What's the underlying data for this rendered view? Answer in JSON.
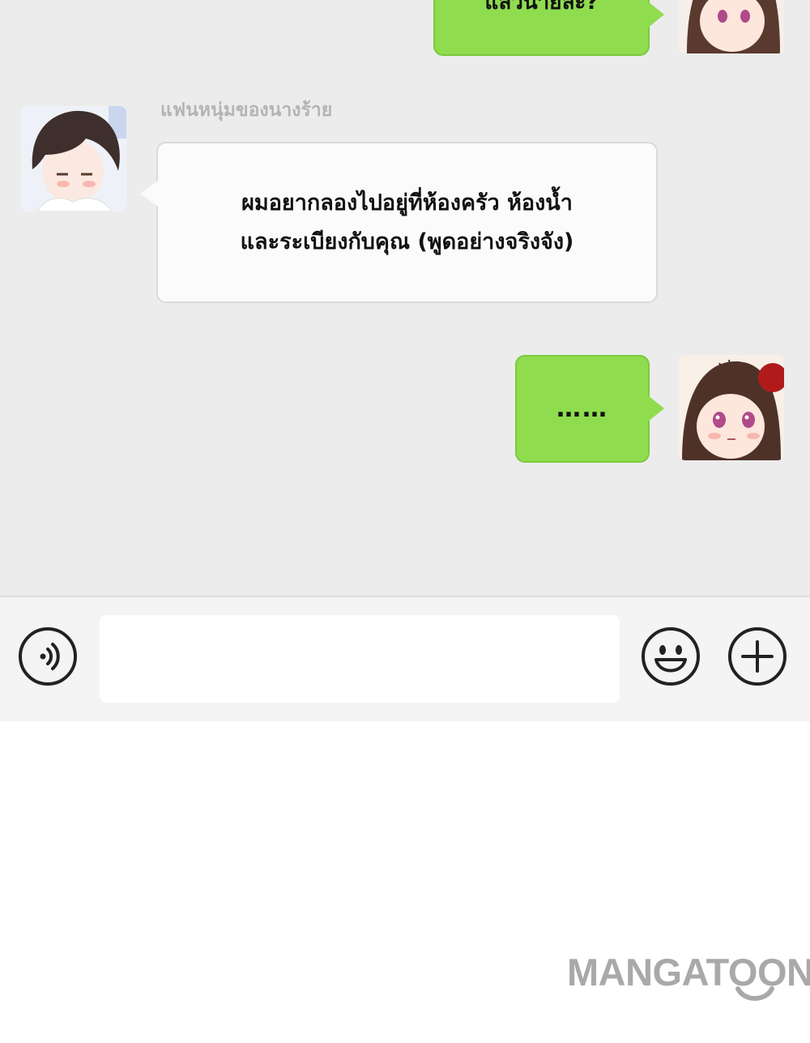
{
  "chat": {
    "messages": [
      {
        "side": "right",
        "sender": "me",
        "text": "แล้วนายล่ะ?",
        "avatar": "girl-avatar"
      },
      {
        "side": "left",
        "sender_name": "แฟนหนุ่มของนางร้าย",
        "lines": [
          "ผมอยากลองไปอยู่ที่ห้องครัว ห้องน้ำ",
          "และระเบียงกับคุณ (พูดอย่างจริงจัง)"
        ],
        "avatar": "boy-avatar"
      },
      {
        "side": "right",
        "sender": "me",
        "text": "……",
        "avatar": "girl-avatar"
      }
    ]
  },
  "input_bar": {
    "voice_icon": "voice-icon",
    "input_value": "",
    "emoji_icon": "emoji-icon",
    "add_icon": "plus-icon"
  },
  "watermark": {
    "text": "MANGATOON"
  },
  "colors": {
    "chat_background": "#ececec",
    "own_bubble": "#8fdc4f",
    "other_bubble": "#fbfbfb",
    "input_bar": "#f4f4f4"
  }
}
